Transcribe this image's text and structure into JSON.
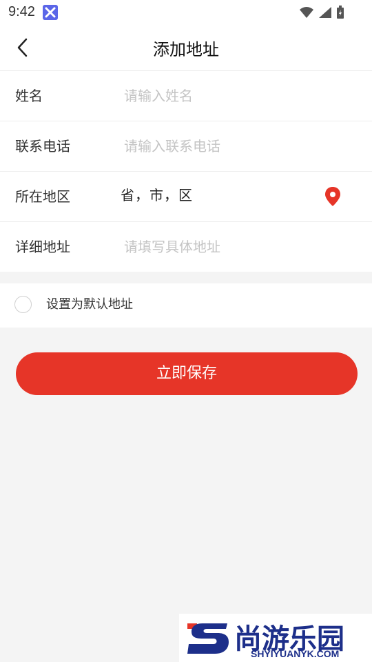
{
  "status_bar": {
    "time": "9:42",
    "icons": [
      "app-notification-icon",
      "wifi-icon",
      "signal-icon",
      "battery-icon"
    ]
  },
  "header": {
    "title": "添加地址",
    "back_icon": "chevron-left-icon"
  },
  "form": {
    "name": {
      "label": "姓名",
      "placeholder": "请输入姓名",
      "value": ""
    },
    "phone": {
      "label": "联系电话",
      "placeholder": "请输入联系电话",
      "value": ""
    },
    "region": {
      "label": "所在地区",
      "value": "省，市，区",
      "icon": "location-pin-icon"
    },
    "detail": {
      "label": "详细地址",
      "placeholder": "请填写具体地址",
      "value": ""
    }
  },
  "default_address": {
    "label": "设置为默认地址",
    "checked": false
  },
  "save_button": {
    "label": "立即保存"
  },
  "watermark": {
    "brand": "尚游乐园",
    "url": "SHYIYUANYK.COM"
  },
  "colors": {
    "accent": "#e63528",
    "background": "#f4f4f4",
    "watermark": "#1d2f8a"
  }
}
